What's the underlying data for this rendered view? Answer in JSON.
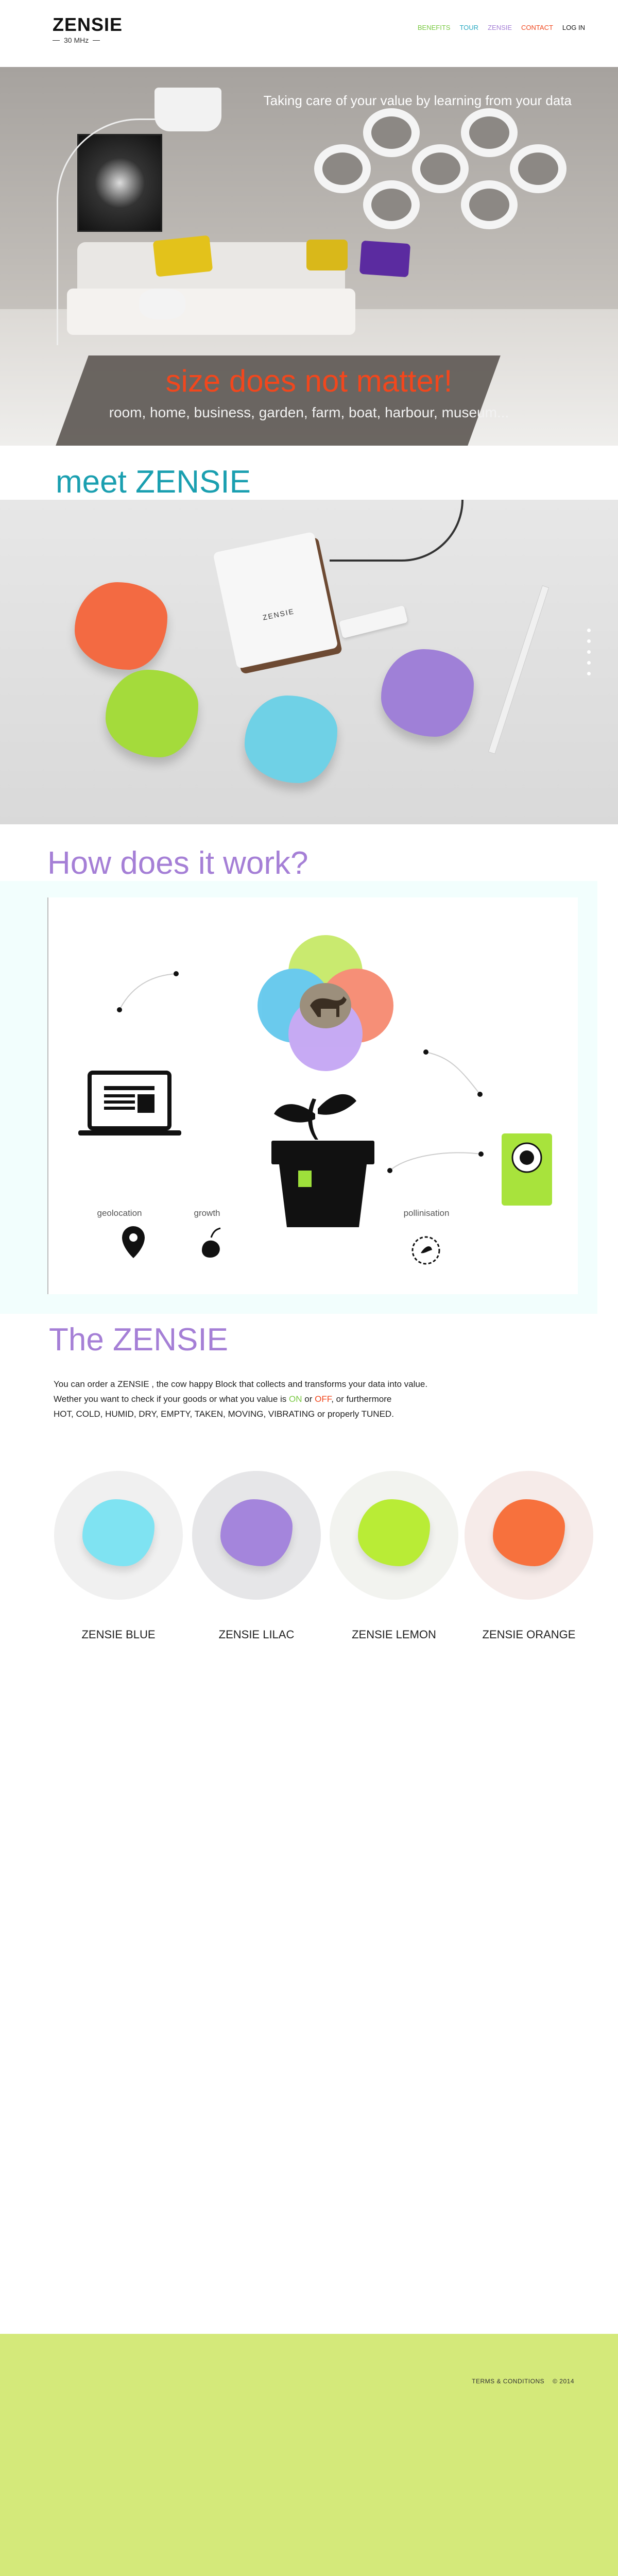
{
  "header": {
    "logo_title": "ZENSIE",
    "logo_subtitle": "30 MHz",
    "nav": [
      {
        "label": "BENEFITS",
        "color": "#7ac943"
      },
      {
        "label": "TOUR",
        "color": "#29a9c2"
      },
      {
        "label": "ZENSIE",
        "color": "#a57fd6"
      },
      {
        "label": "CONTACT",
        "color": "#f1471d"
      },
      {
        "label": "LOG IN",
        "color": "#111111"
      }
    ]
  },
  "hero": {
    "tagline": "Taking care of your value by learning from your data",
    "title": "size does not matter!",
    "subtitle": "room, home, business, garden, farm, boat, harbour, museum..."
  },
  "meet": {
    "title": "meet ZENSIE",
    "case_label": "ZENSIE",
    "carousel_dots": 5
  },
  "how": {
    "title": "How does it work?",
    "labels": {
      "geolocation": "geolocation",
      "growth": "growth",
      "pollinisation": "pollinisation"
    }
  },
  "zensie": {
    "title": "The ZENSIE",
    "line1": "You can order a  ZENSIE , the cow happy Block that collects and  transforms your data into value.",
    "line2_pre": "Wether you want to check if  your goods or what you value is ",
    "on": "ON",
    "or": " or ",
    "off": "OFF",
    "line2_post": ", or furthermore",
    "line3": "HOT, COLD, HUMID,  DRY,  EMPTY, TAKEN, MOVING, VIBRATING   or  properly TUNED.",
    "products": [
      {
        "name": "ZENSIE BLUE",
        "color": "#7fe3f2",
        "bg": "#f0f0f0"
      },
      {
        "name": "ZENSIE LILAC",
        "color": "#a485dc",
        "bg": "#e6e6e8"
      },
      {
        "name": "ZENSIE LEMON",
        "color": "#b9ec36",
        "bg": "#f2f3ef"
      },
      {
        "name": "ZENSIE ORANGE",
        "color": "#f7713d",
        "bg": "#f6ebe9"
      }
    ]
  },
  "footer": {
    "terms": "TERMS & CONDITIONS",
    "copyright": "© 2014"
  }
}
